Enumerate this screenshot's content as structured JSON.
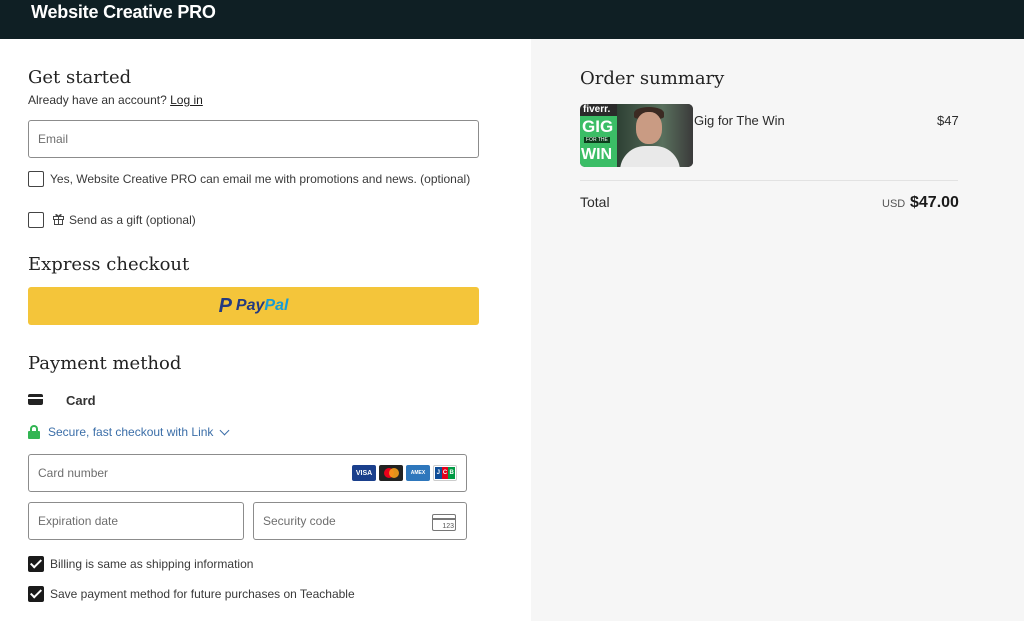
{
  "header": {
    "brand": "Website Creative PRO"
  },
  "left": {
    "get_started": {
      "title": "Get started",
      "account_prompt": "Already have an account?",
      "login_link": "Log in",
      "email_placeholder": "Email",
      "email_value": "",
      "promo_optin_label": "Yes, Website Creative PRO can email me with promotions and news. (optional)",
      "promo_optin_checked": false,
      "gift_label": "Send as a gift (optional)",
      "gift_checked": false
    },
    "express": {
      "title": "Express checkout",
      "paypal_pay": "Pay",
      "paypal_pal": "Pal",
      "paypal_mark": "P"
    },
    "payment": {
      "title": "Payment method",
      "card_label": "Card",
      "link_text": "Secure, fast checkout with Link",
      "card_number_placeholder": "Card number",
      "expiration_placeholder": "Expiration date",
      "security_placeholder": "Security code",
      "cvc_hint": "123",
      "brands": {
        "visa": "VISA",
        "amex": "AMEX",
        "jcb": [
          "J",
          "C",
          "B"
        ]
      },
      "billing_same_label": "Billing is same as shipping information",
      "billing_same_checked": true,
      "save_payment_label": "Save payment method for future purchases on Teachable",
      "save_payment_checked": true
    }
  },
  "summary": {
    "title": "Order summary",
    "item": {
      "name": "Gig for The Win",
      "price": "$47",
      "thumbnail_text": {
        "brand": "fiverr.",
        "line1": "GIG",
        "line2": "FOR THE",
        "line3": "WIN"
      }
    },
    "total_label": "Total",
    "currency": "USD",
    "total_value": "$47.00"
  }
}
